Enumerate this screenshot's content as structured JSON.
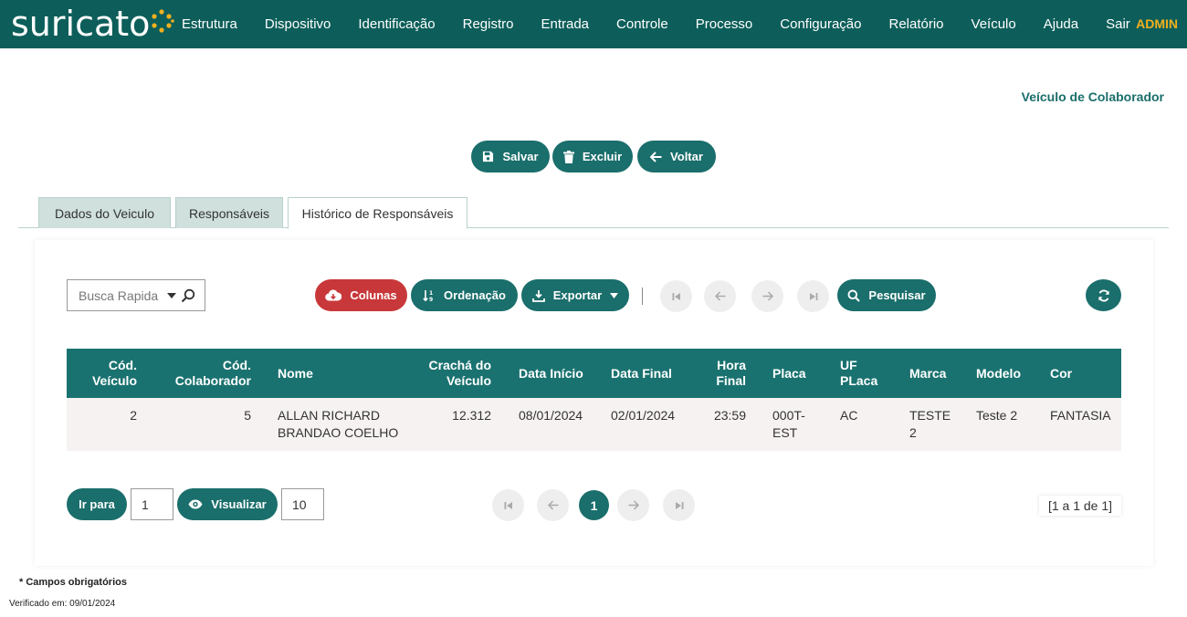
{
  "app": {
    "logo": "suricato",
    "user": "ADMIN"
  },
  "nav": [
    "Estrutura",
    "Dispositivo",
    "Identificação",
    "Registro",
    "Entrada",
    "Controle",
    "Processo",
    "Configuração",
    "Relatório",
    "Veículo",
    "Ajuda",
    "Sair"
  ],
  "page": {
    "title": "Veículo de Colaborador"
  },
  "actions": {
    "save": "Salvar",
    "delete": "Excluir",
    "back": "Voltar"
  },
  "tabs": [
    "Dados do Veiculo",
    "Responsáveis",
    "Histórico de Responsáveis"
  ],
  "toolbar": {
    "search_placeholder": "Busca Rapida",
    "columns": "Colunas",
    "sort": "Ordenação",
    "export": "Exportar",
    "search": "Pesquisar"
  },
  "table": {
    "headers": [
      [
        "Cód.",
        "Veículo"
      ],
      [
        "Cód.",
        "Colaborador"
      ],
      [
        "Nome"
      ],
      [
        "Crachá do",
        "Veículo"
      ],
      [
        "Data Início"
      ],
      [
        "Data Final"
      ],
      [
        "Hora",
        "Final"
      ],
      [
        "Placa"
      ],
      [
        "UF",
        "PLaca"
      ],
      [
        "Marca"
      ],
      [
        "Modelo"
      ],
      [
        "Cor"
      ]
    ],
    "rows": [
      {
        "cod_veiculo": "2",
        "cod_colaborador": "5",
        "nome": [
          "ALLAN RICHARD",
          "BRANDAO COELHO"
        ],
        "cracha": "12.312",
        "data_inicio": "08/01/2024",
        "data_final": "02/01/2024",
        "hora_final": "23:59",
        "placa": [
          "000T-",
          "EST"
        ],
        "uf": "AC",
        "marca": [
          "TESTE",
          "2"
        ],
        "modelo": "Teste 2",
        "cor": "FANTASIA"
      }
    ]
  },
  "pagination": {
    "goto_label": "Ir para",
    "goto_value": "1",
    "view_label": "Visualizar",
    "view_value": "10",
    "current_page": "1",
    "range": "[1 a 1 de 1]"
  },
  "footer": {
    "required": "* Campos obrigatórios",
    "verified": "Verificado em: 09/01/2024"
  }
}
